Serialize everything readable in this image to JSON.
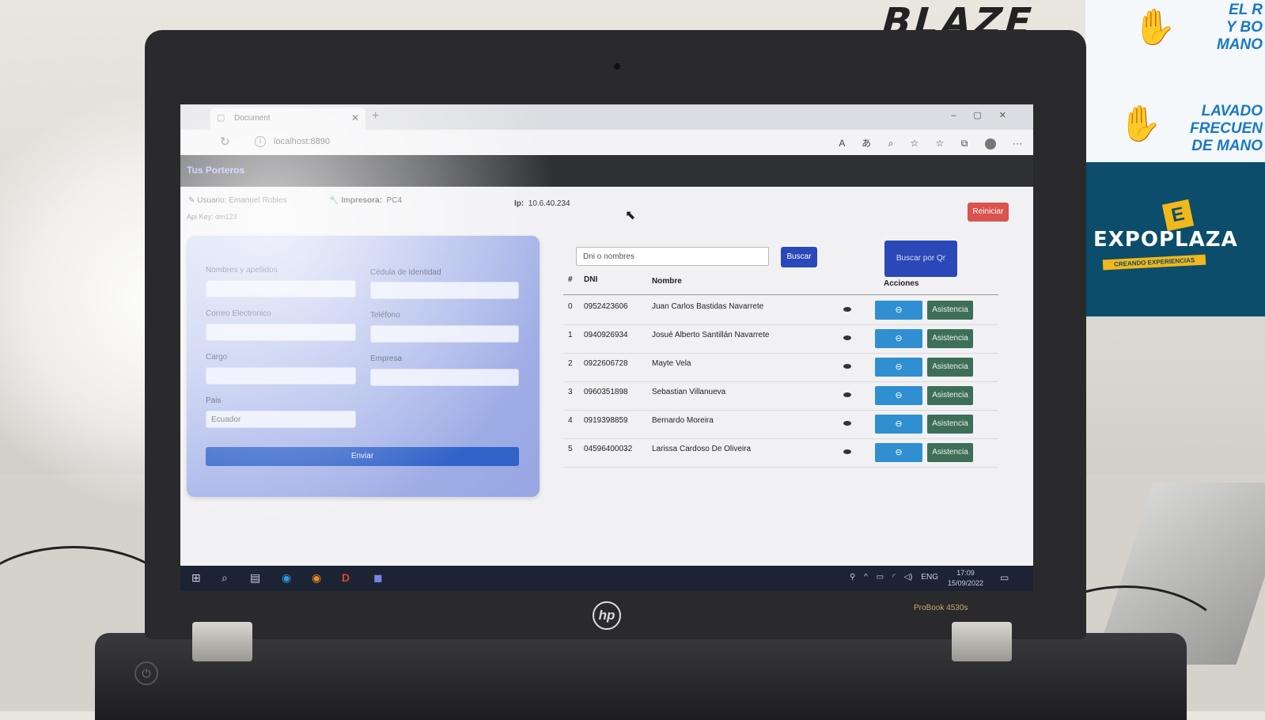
{
  "browser": {
    "tab_title": "Document",
    "url": "localhost:8890"
  },
  "app": {
    "brand": "Tus Porteros",
    "user_label": "Usuario:",
    "user_name": "Emanuel Robles",
    "printer_label": "Impresora:",
    "printer_value": "PC4",
    "ip_label": "Ip:",
    "ip_value": "10.6.40.234",
    "api_key": "Api Key: dm123",
    "reset_button": "Reiniciar"
  },
  "form": {
    "name_label": "Nombres y apellidos",
    "id_label": "Cédula de Identidad",
    "email_label": "Correo Electronico",
    "phone_label": "Teléfono",
    "role_label": "Cargo",
    "company_label": "Empresa",
    "country_label": "Pais",
    "country_value": "Ecuador",
    "submit": "Enviar"
  },
  "search": {
    "placeholder": "Dni o nombres",
    "button": "Buscar",
    "qr_button": "Buscar por Qr"
  },
  "table": {
    "headers": {
      "index": "#",
      "dni": "DNI",
      "name": "Nombre",
      "actions": "Acciones"
    },
    "attendance_label": "Asistencia",
    "rows": [
      {
        "index": "0",
        "dni": "0952423606",
        "name": "Juan Carlos Bastidas Navarrete"
      },
      {
        "index": "1",
        "dni": "0940926934",
        "name": "Josué Alberto Santillán Navarrete"
      },
      {
        "index": "2",
        "dni": "0922606728",
        "name": "Mayte Vela"
      },
      {
        "index": "3",
        "dni": "0960351898",
        "name": "Sebastian Villanueva"
      },
      {
        "index": "4",
        "dni": "0919398859",
        "name": "Bernardo Moreira"
      },
      {
        "index": "5",
        "dni": "04596400032",
        "name": "Larissa Cardoso De Oliveira"
      }
    ]
  },
  "taskbar": {
    "language": "ENG",
    "time": "17:09",
    "date": "15/09/2022"
  },
  "surroundings": {
    "laptop_model": "ProBook 4530s",
    "brand_logo": "hp",
    "bg_sign": "BLAZE",
    "banner_text_1": "EL R\nY BO\nMANO",
    "banner_text_2": "LAVADO\nFRECUEN\nDE MANO",
    "expo_logo": "EXPOPLAZA",
    "expo_sub": "CREANDO EXPERIENCIAS"
  },
  "colors": {
    "reset": "#d9534f",
    "primary": "#2b48b8",
    "view": "#2f8fd0",
    "attendance": "#3d6f58",
    "appbar": "#2f3033"
  }
}
